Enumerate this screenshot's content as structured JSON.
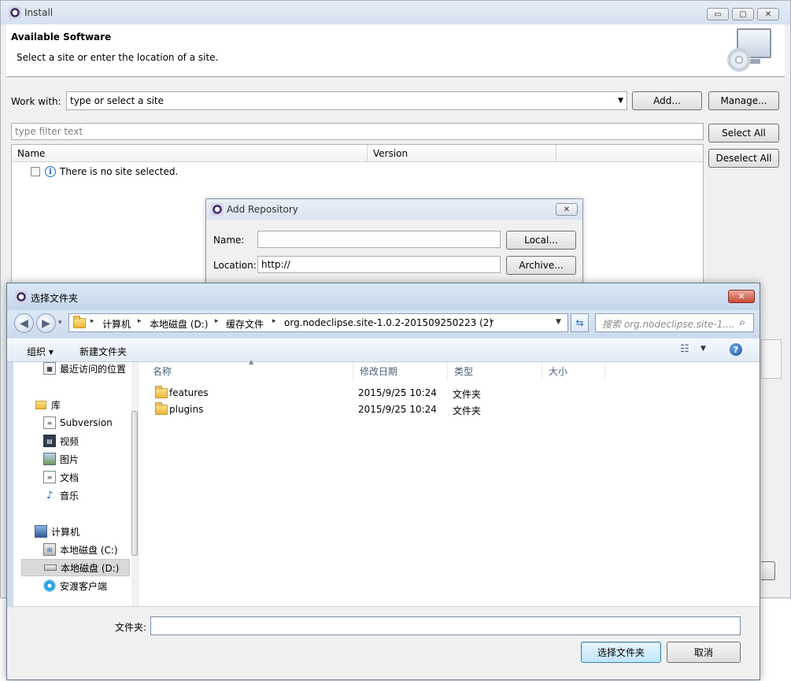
{
  "install": {
    "title": "Install",
    "window_buttons": {
      "minimize": "▭",
      "maximize": "▢",
      "close": "✕"
    },
    "header_title": "Available Software",
    "header_subtitle": "Select a site or enter the location of a site.",
    "work_with_label": "Work with:",
    "work_with_value": "type or select a site",
    "add_label": "Add...",
    "manage_label": "Manage...",
    "filter_placeholder": "type filter text",
    "select_all_label": "Select All",
    "deselect_all_label": "Deselect All",
    "columns": [
      "Name",
      "Version"
    ],
    "empty_message": "There is no site selected."
  },
  "add_repository": {
    "title": "Add Repository",
    "close_glyph": "✕",
    "name_label": "Name:",
    "name_value": "",
    "location_label": "Location:",
    "location_value": "http://",
    "local_label": "Local...",
    "archive_label": "Archive..."
  },
  "chooser": {
    "title": "选择文件夹",
    "close_glyph": "✕",
    "breadcrumb": [
      "计算机",
      "本地磁盘 (D:)",
      "缓存文件",
      "org.nodeclipse.site-1.0.2-201509250223 (2)"
    ],
    "search_placeholder": "搜索 org.nodeclipse.site-1....",
    "organize_label": "组织 ▾",
    "new_folder_label": "新建文件夹",
    "help_glyph": "?",
    "nav": {
      "recent": "最近访问的位置",
      "libraries": "库",
      "subversion": "Subversion",
      "videos": "视频",
      "pictures": "图片",
      "documents": "文档",
      "music": "音乐",
      "computer": "计算机",
      "drive_c": "本地磁盘 (C:)",
      "drive_d": "本地磁盘 (D:)",
      "anyshare": "安渡客户端"
    },
    "columns": [
      "名称",
      "修改日期",
      "类型",
      "大小"
    ],
    "rows": [
      {
        "name": "features",
        "date": "2015/9/25 10:24",
        "type": "文件夹"
      },
      {
        "name": "plugins",
        "date": "2015/9/25 10:24",
        "type": "文件夹"
      }
    ],
    "folder_label": "文件夹:",
    "folder_value": "",
    "ok_label": "选择文件夹",
    "cancel_label": "取消"
  }
}
